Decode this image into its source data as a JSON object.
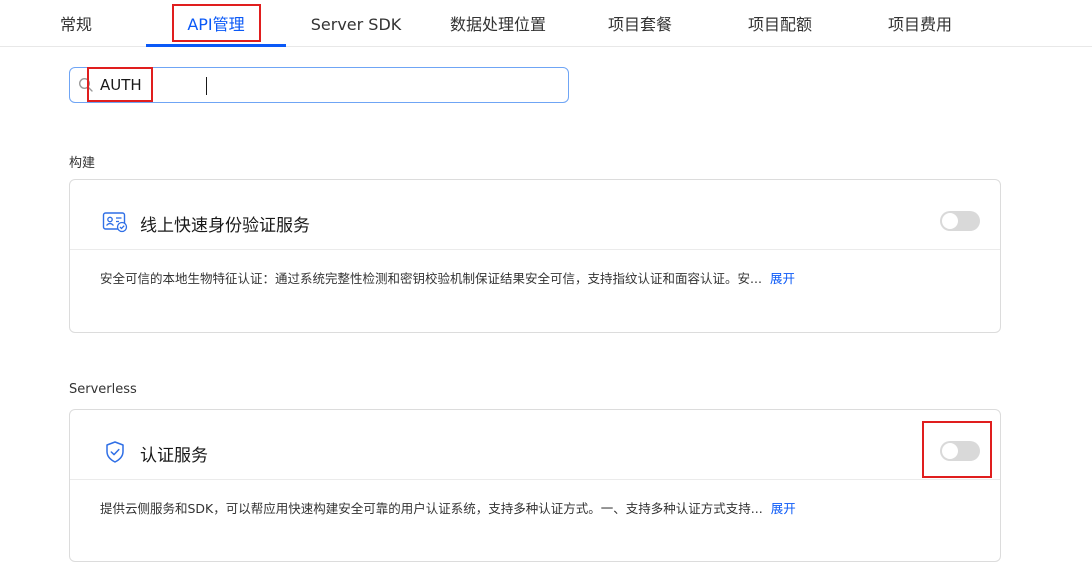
{
  "tabs": [
    {
      "label": "常规",
      "active": false
    },
    {
      "label": "API管理",
      "active": true
    },
    {
      "label": "Server SDK",
      "active": false
    },
    {
      "label": "数据处理位置",
      "active": false
    },
    {
      "label": "项目套餐",
      "active": false
    },
    {
      "label": "项目配额",
      "active": false
    },
    {
      "label": "项目费用",
      "active": false
    }
  ],
  "search": {
    "value": "AUTH",
    "icon": "search-icon"
  },
  "sections": [
    {
      "title": "构建",
      "card": {
        "icon": "id-card-icon",
        "title": "线上快速身份验证服务",
        "enabled": false,
        "description": "安全可信的本地生物特征认证：通过系统完整性检测和密钥校验机制保证结果安全可信，支持指纹认证和面容认证。安...",
        "expand_label": "展开"
      }
    },
    {
      "title": "Serverless",
      "card": {
        "icon": "shield-check-icon",
        "title": "认证服务",
        "enabled": false,
        "description": "提供云侧服务和SDK，可以帮应用快速构建安全可靠的用户认证系统，支持多种认证方式。一、支持多种认证方式支持...",
        "expand_label": "展开"
      }
    }
  ],
  "colors": {
    "accent": "#0a59f7",
    "highlight": "#e01e1e",
    "toggle_off": "#d9d9d9"
  }
}
